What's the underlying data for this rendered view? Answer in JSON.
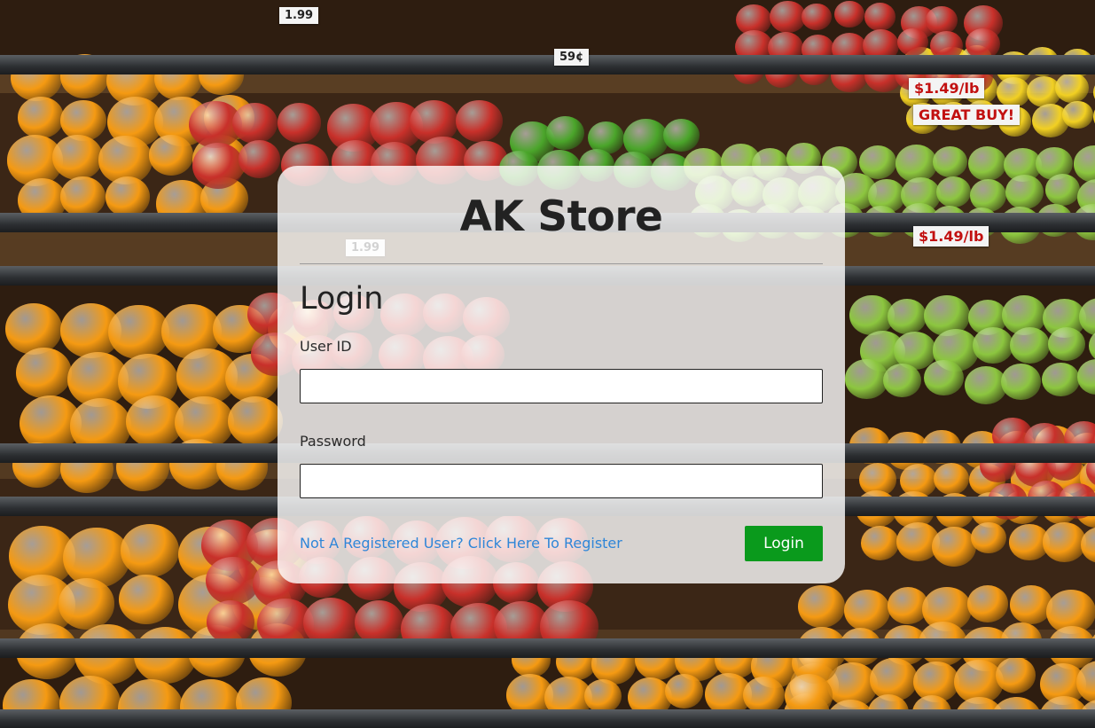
{
  "store": {
    "title": "AK Store"
  },
  "login": {
    "heading": "Login",
    "user_id_label": "User ID",
    "user_id_value": "",
    "password_label": "Password",
    "password_value": "",
    "register_link": "Not A Registered User? Click Here To Register",
    "login_button": "Login"
  },
  "background": {
    "price_tags": [
      "1.99",
      "59¢",
      "1.99",
      "$1.49/lb",
      "$1.49/lb",
      "GREAT BUY!"
    ]
  },
  "colors": {
    "accent_link": "#2f86d8",
    "login_button": "#0a9a1c",
    "orange_fruit": "#f59a12",
    "red_apple": "#c8302a",
    "green_apple": "#8cc63f",
    "lime": "#4aa52a",
    "yellow_apple": "#f2d022"
  }
}
